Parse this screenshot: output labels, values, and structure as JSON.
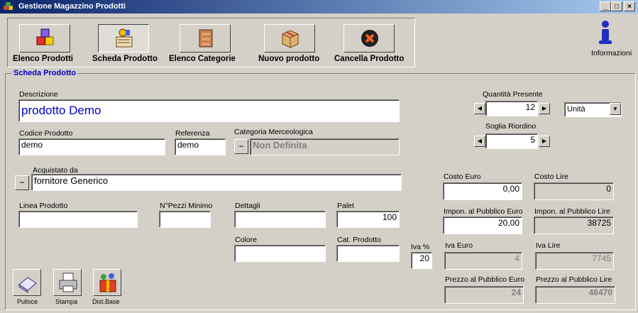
{
  "window": {
    "title": "Gestione Magazzino Prodotti",
    "min": "_",
    "max": "□",
    "close": "×"
  },
  "toolbar": {
    "elenco_prodotti": "Elenco Prodotti",
    "scheda_prodotto": "Scheda Prodotto",
    "elenco_categorie": "Elenco Categorie",
    "nuovo_prodotto": "Nuovo prodotto",
    "cancella_prodotto": "Cancella Prodotto",
    "informazioni": "Informazioni"
  },
  "scheda": {
    "title": "Scheda Prodotto",
    "descrizione_label": "Descrizione",
    "descrizione": "prodotto Demo",
    "codice_label": "Codice Prodotto",
    "codice": "demo",
    "referenza_label": "Referenza",
    "referenza": "demo",
    "categoria_label": "Categoria Merceologica",
    "categoria_btn": "..",
    "categoria": "Non Definita",
    "acquistato_label": "Acquistato da",
    "acquistato_btn": "..",
    "acquistato": "fornitore Generico",
    "linea_label": "Linea Prodotto",
    "linea": "",
    "pezzi_label": "N°Pezzi Minimo",
    "pezzi": "",
    "dettagli_label": "Dettagli",
    "dettagli": "",
    "palet_label": "Palet",
    "palet": "100",
    "colore_label": "Colore",
    "colore": "",
    "cat_label": "Cat. Prodotto",
    "cat": "",
    "iva_pct_label": "Iva %",
    "iva_pct": "20",
    "qta_label": "Quantità Presente",
    "qta": "12",
    "unita": "Unità",
    "soglia_label": "Soglia Riordino",
    "soglia": "5",
    "costo_euro_label": "Costo Euro",
    "costo_euro": "0,00",
    "costo_lire_label": "Costo Lire",
    "costo_lire": "0",
    "impon_euro_label": "Impon. al Pubblico Euro",
    "impon_euro": "20,00",
    "impon_lire_label": "Impon. al Pubblico Lire",
    "impon_lire": "38725",
    "iva_euro_label": "Iva Euro",
    "iva_euro": "4",
    "iva_lire_label": "Iva Lire",
    "iva_lire": "7745",
    "prezzo_euro_label": "Prezzo al Pubblico Euro",
    "prezzo_euro": "24",
    "prezzo_lire_label": "Prezzo al Pubblico Lire",
    "prezzo_lire": "46470"
  },
  "bottom": {
    "pulisce": "Pulisce",
    "stampa": "Stampa",
    "distbase": "Dist.Base"
  }
}
